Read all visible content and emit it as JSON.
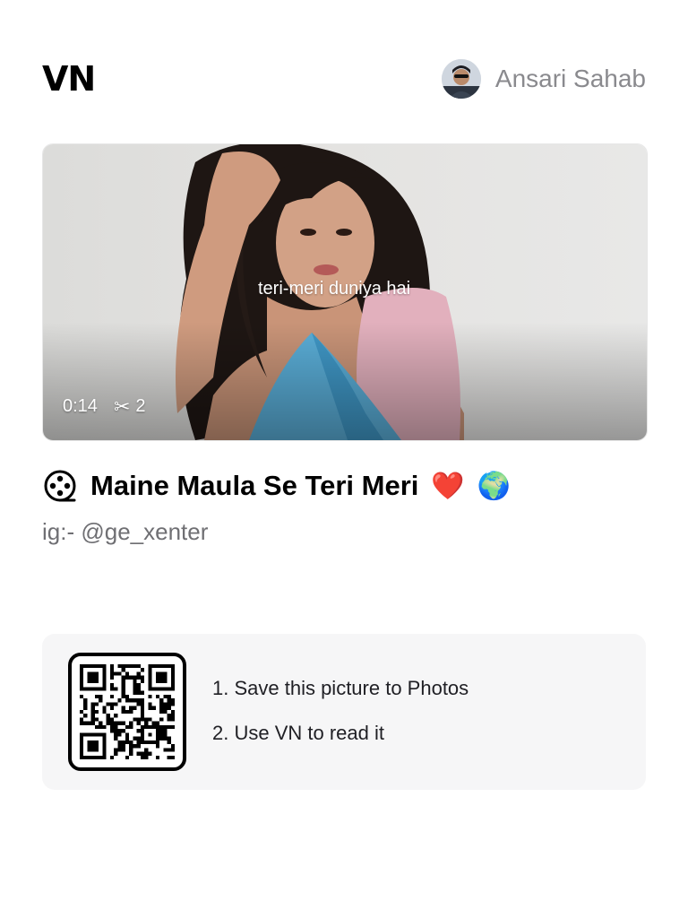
{
  "header": {
    "logo": "VN",
    "user_name": "Ansari Sahab"
  },
  "video": {
    "subtitle": "teri-meri duniya hai",
    "duration": "0:14",
    "clip_count": "2",
    "scissors_icon": "✂"
  },
  "project": {
    "title": "Maine Maula Se Teri Meri",
    "emoji_heart": "❤️",
    "emoji_globe": "🌍",
    "description": "ig:- @ge_xenter"
  },
  "qr": {
    "step1": "1. Save this picture to Photos",
    "step2": "2. Use VN to read it"
  },
  "colors": {
    "username": "#8a8a8e",
    "description": "#6f6f73",
    "panel_bg": "#f6f6f7"
  }
}
